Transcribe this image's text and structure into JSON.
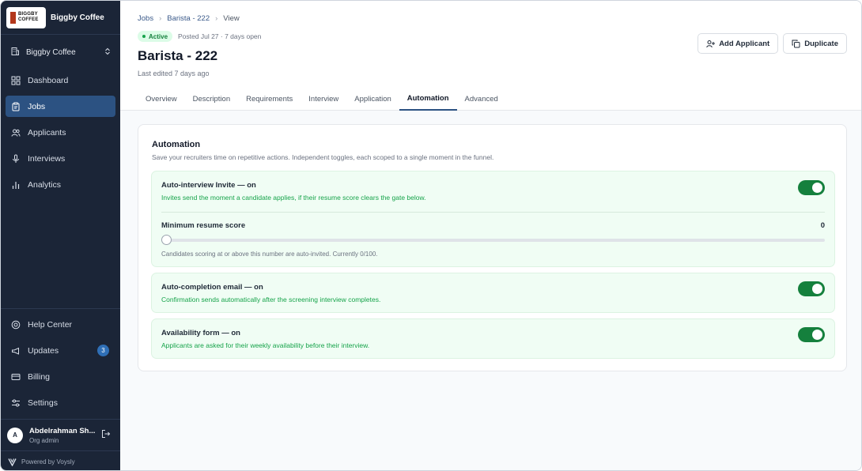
{
  "brand": {
    "logo_line1": "BIGGBY",
    "logo_line2": "COFFEE",
    "name": "Biggby Coffee"
  },
  "org": {
    "name": "Biggby Coffee"
  },
  "sidebar": {
    "items": [
      {
        "label": "Dashboard",
        "icon": "dashboard-icon"
      },
      {
        "label": "Jobs",
        "icon": "clipboard-icon",
        "active": true
      },
      {
        "label": "Applicants",
        "icon": "users-icon"
      },
      {
        "label": "Interviews",
        "icon": "microphone-icon"
      },
      {
        "label": "Analytics",
        "icon": "bar-chart-icon"
      }
    ],
    "bottom_items": [
      {
        "label": "Help Center",
        "icon": "lifebuoy-icon"
      },
      {
        "label": "Updates",
        "icon": "megaphone-icon",
        "badge": "3"
      },
      {
        "label": "Billing",
        "icon": "credit-card-icon"
      },
      {
        "label": "Settings",
        "icon": "sliders-icon"
      }
    ]
  },
  "user": {
    "initial": "A",
    "name": "Abdelrahman Sh...",
    "role": "Org admin"
  },
  "powered_by": "Powered by Voysly",
  "breadcrumb": {
    "jobs": "Jobs",
    "job": "Barista - 222",
    "current": "View"
  },
  "job": {
    "status": "Active",
    "posted": "Posted Jul 27 · 7 days open",
    "title": "Barista - 222",
    "edited": "Last edited 7 days ago"
  },
  "actions": {
    "add_applicant": "Add Applicant",
    "duplicate": "Duplicate"
  },
  "tabs": [
    "Overview",
    "Description",
    "Requirements",
    "Interview",
    "Application",
    "Automation",
    "Advanced"
  ],
  "active_tab": "Automation",
  "automation": {
    "title": "Automation",
    "subtitle": "Save your recruiters time on repetitive actions. Independent toggles, each scoped to a single moment in the funnel.",
    "auto_interview": {
      "title": "Auto-interview Invite — on",
      "desc": "Invites send the moment a candidate applies, if their resume score clears the gate below.",
      "enabled": true
    },
    "min_score": {
      "label": "Minimum resume score",
      "value": "0",
      "fraction": 0,
      "note": "Candidates scoring at or above this number are auto-invited. Currently 0/100."
    },
    "auto_completion": {
      "title": "Auto-completion email — on",
      "desc": "Confirmation sends automatically after the screening interview completes.",
      "enabled": true
    },
    "availability": {
      "title": "Availability form — on",
      "desc": "Applicants are asked for their weekly availability before their interview.",
      "enabled": true
    }
  },
  "colors": {
    "sidebar_bg": "#1b2537",
    "accent": "#2c5282",
    "toggle_on": "#15803d",
    "panel_bg": "#f0fdf4"
  }
}
